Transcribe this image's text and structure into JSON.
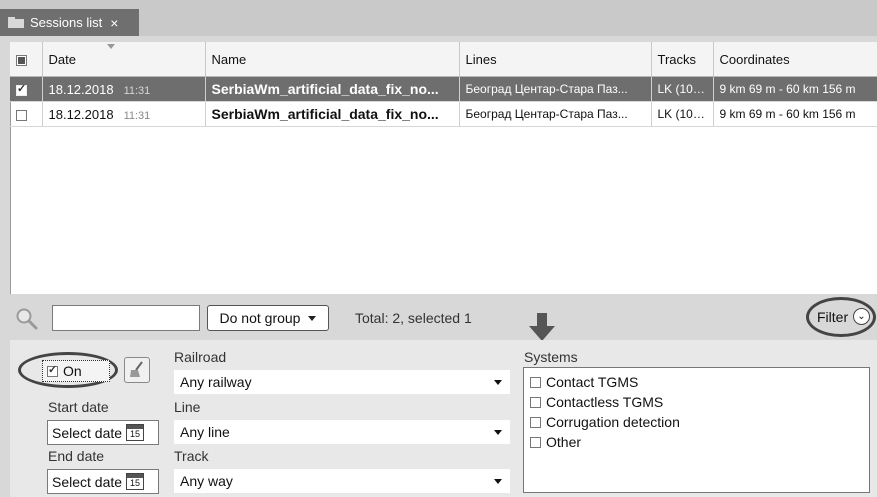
{
  "tab": {
    "title": "Sessions list",
    "close": "×"
  },
  "columns": [
    "Date",
    "Name",
    "Lines",
    "Tracks",
    "Coordinates"
  ],
  "rows": [
    {
      "selected": true,
      "date": "18.12.2018",
      "time": "11:31",
      "name": "SerbiaWm_artificial_data_fix_no...",
      "lines": "Београд Центар-Стара Паз...",
      "tracks": "LK (101...",
      "coords": "9 km 69 m - 60 km 156 m"
    },
    {
      "selected": false,
      "date": "18.12.2018",
      "time": "11:31",
      "name": "SerbiaWm_artificial_data_fix_no...",
      "lines": "Београд Центар-Стара Паз...",
      "tracks": "LK (101...",
      "coords": "9 km 69 m - 60 km 156 m"
    }
  ],
  "toolbar": {
    "search_value": "",
    "group_label": "Do not group",
    "total_text": "Total: 2, selected 1",
    "filter_label": "Filter"
  },
  "filter": {
    "on_label": "On",
    "railroad_label": "Railroad",
    "railroad_value": "Any railway",
    "start_date_label": "Start date",
    "start_date_value": "Select date",
    "line_label": "Line",
    "line_value": "Any line",
    "end_date_label": "End date",
    "end_date_value": "Select date",
    "track_label": "Track",
    "track_value": "Any way",
    "calendar_day": "15",
    "systems_label": "Systems",
    "systems": [
      "Contact TGMS",
      "Contactless TGMS",
      "Corrugation detection",
      "Other"
    ]
  }
}
